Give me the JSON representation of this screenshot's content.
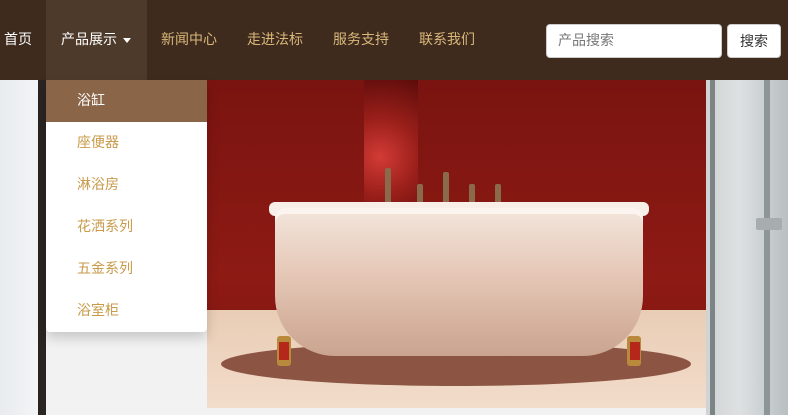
{
  "navbar": {
    "items": [
      {
        "label": "首页"
      },
      {
        "label": "产品展示"
      },
      {
        "label": "新闻中心"
      },
      {
        "label": "走进法标"
      },
      {
        "label": "服务支持"
      },
      {
        "label": "联系我们"
      }
    ],
    "search": {
      "placeholder": "产品搜索",
      "value": "",
      "button_label": "搜索"
    }
  },
  "dropdown": {
    "items": [
      {
        "label": "浴缸",
        "active": true
      },
      {
        "label": "座便器",
        "active": false
      },
      {
        "label": "淋浴房",
        "active": false
      },
      {
        "label": "花洒系列",
        "active": false
      },
      {
        "label": "五金系列",
        "active": false
      },
      {
        "label": "浴室柜",
        "active": false
      }
    ]
  },
  "colors": {
    "navbar_bg": "#3e2b1e",
    "nav_link": "#d9b77a",
    "dropdown_active_bg": "#8b6548",
    "dropdown_link": "#c89a4a"
  }
}
